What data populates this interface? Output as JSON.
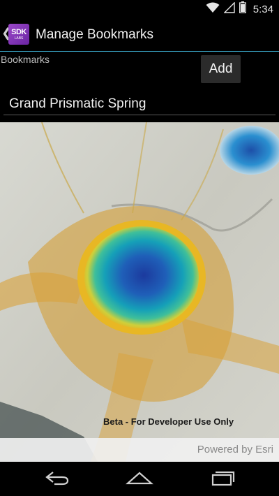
{
  "status_bar": {
    "time": "5:34",
    "icons": [
      "wifi-icon",
      "signal-icon",
      "battery-icon"
    ]
  },
  "action_bar": {
    "title": "Manage Bookmarks",
    "app_icon_text": "SDK",
    "app_icon_subtext": "LABS"
  },
  "form": {
    "bookmarks_label": "Bookmarks",
    "add_label": "Add",
    "selected_bookmark": "Grand Prismatic Spring"
  },
  "map": {
    "watermark": "Beta - For Developer Use Only",
    "attribution": "Powered by Esri"
  },
  "nav_bar": {
    "icons": [
      "back-icon",
      "home-icon",
      "recent-apps-icon"
    ]
  },
  "colors": {
    "accent": "#3aa6c8",
    "background": "#000000"
  }
}
